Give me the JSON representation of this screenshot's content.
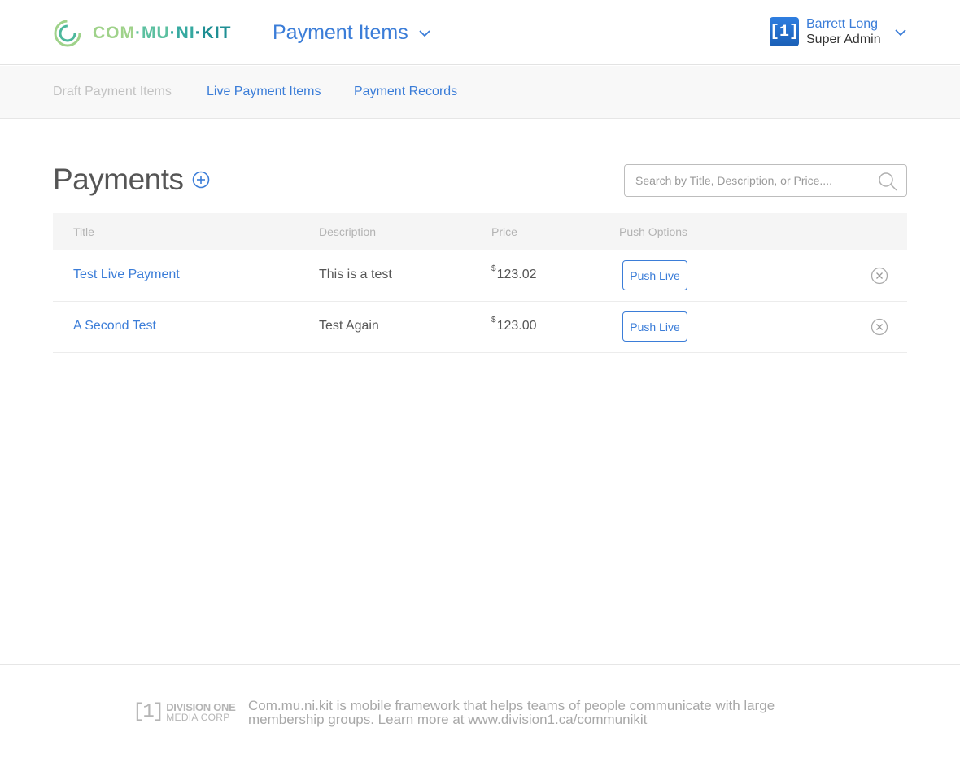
{
  "header": {
    "logo_text": [
      "COM",
      "·MU",
      "·NI",
      "·KIT"
    ],
    "page_switch_label": "Payment Items",
    "user": {
      "avatar_text": "[1]",
      "name": "Barrett Long",
      "role": "Super Admin"
    }
  },
  "subnav": {
    "items": [
      {
        "label": "Draft Payment Items",
        "active": false
      },
      {
        "label": "Live Payment Items",
        "active": true
      },
      {
        "label": "Payment Records",
        "active": true
      }
    ]
  },
  "main": {
    "title": "Payments",
    "search_placeholder": "Search by Title, Description, or Price....",
    "columns": [
      "Title",
      "Description",
      "Price",
      "Push Options"
    ],
    "rows": [
      {
        "title": "Test Live Payment",
        "description": "This is a test",
        "currency": "$",
        "price": "123.02",
        "push_label": "Push Live"
      },
      {
        "title": "A Second Test",
        "description": "Test Again",
        "currency": "$",
        "price": "123.00",
        "push_label": "Push Live"
      }
    ]
  },
  "footer": {
    "logo_bracket": "[1]",
    "logo_line1": "DIVISION ONE",
    "logo_line2": "MEDIA CORP",
    "text": "Com.mu.ni.kit is mobile framework that helps teams of people communicate with large membership groups. Learn more at www.division1.ca/communikit"
  },
  "colors": {
    "accent": "#3b7dd8",
    "muted": "#c2c2c2",
    "logo_green": "#9fd28a",
    "logo_teal": "#1f8f94"
  }
}
